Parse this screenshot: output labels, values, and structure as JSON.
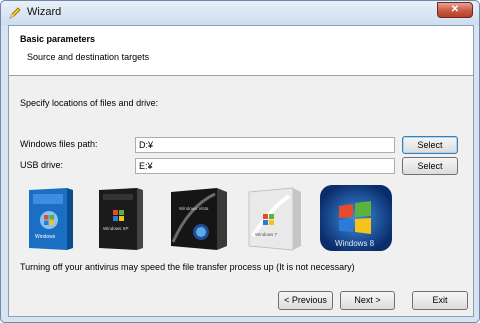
{
  "window": {
    "title": "Wizard",
    "close_label": "✕"
  },
  "header": {
    "title": "Basic parameters",
    "subtitle": "Source and destination targets"
  },
  "main": {
    "instruction": "Specify locations of files and drive:",
    "windows_path": {
      "label": "Windows files path:",
      "value": "D:¥",
      "button": "Select"
    },
    "usb_drive": {
      "label": "USB drive:",
      "value": "E:¥",
      "button": "Select"
    },
    "products": [
      {
        "name": "windows-xp-box",
        "text": "Windows"
      },
      {
        "name": "windows-xp-pro-box",
        "text": "Windows XP"
      },
      {
        "name": "windows-vista-box",
        "text": "Windows Vista"
      },
      {
        "name": "windows-7-box",
        "text": "Windows 7"
      },
      {
        "name": "windows-8-logo",
        "text": "Windows 8"
      }
    ],
    "note": "Turning off your antivirus may speed the file transfer process up (It is not necessary)"
  },
  "footer": {
    "previous": "< Previous",
    "next": "Next >",
    "exit": "Exit"
  }
}
